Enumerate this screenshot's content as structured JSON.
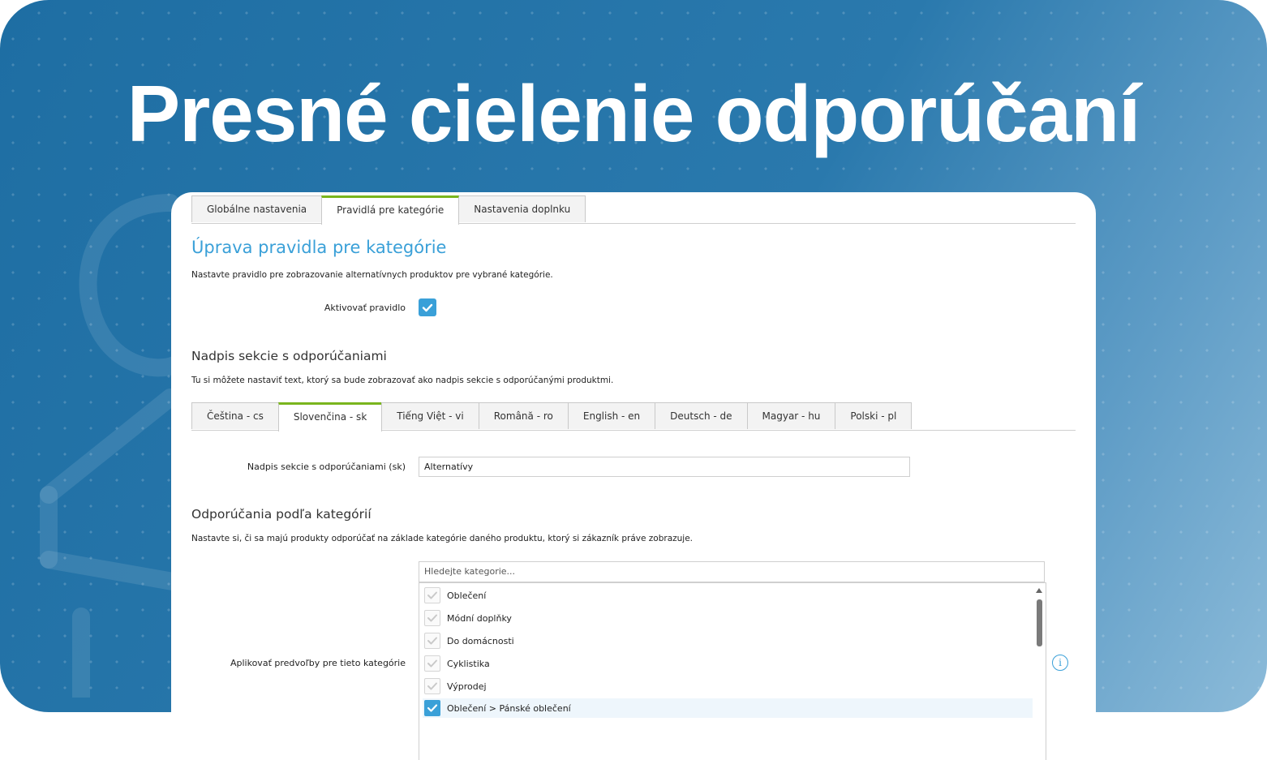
{
  "headline": "Presné cielenie odporúčaní",
  "colors": {
    "accent": "#3aa0d8",
    "tab_active": "#7ab51d",
    "background": "#2a79ad"
  },
  "main_tabs": [
    {
      "label": "Globálne nastavenia",
      "active": false
    },
    {
      "label": "Pravidlá pre kategórie",
      "active": true
    },
    {
      "label": "Nastavenia doplnku",
      "active": false
    }
  ],
  "rule": {
    "title": "Úprava pravidla pre kategórie",
    "description": "Nastavte pravidlo pre zobrazovanie alternatívnych produktov pre vybrané kategórie.",
    "activate_label": "Aktivovať pravidlo",
    "activate_checked": true
  },
  "heading_section": {
    "title": "Nadpis sekcie s odporúčaniami",
    "description": "Tu si môžete nastaviť text, ktorý sa bude zobrazovať ako nadpis sekcie s odporúčanými produktmi.",
    "languages": [
      {
        "label": "Čeština - cs",
        "active": false
      },
      {
        "label": "Slovenčina - sk",
        "active": true
      },
      {
        "label": "Tiếng Việt - vi",
        "active": false
      },
      {
        "label": "Română - ro",
        "active": false
      },
      {
        "label": "English - en",
        "active": false
      },
      {
        "label": "Deutsch - de",
        "active": false
      },
      {
        "label": "Magyar - hu",
        "active": false
      },
      {
        "label": "Polski - pl",
        "active": false
      }
    ],
    "field_label": "Nadpis sekcie s odporúčaniami (sk)",
    "field_value": "Alternatívy"
  },
  "category_section": {
    "title": "Odporúčania podľa kategórií",
    "description": "Nastavte si, či sa majú produkty odporúčať na základe kategórie daného produktu, ktorý si zákazník práve zobrazuje.",
    "apply_label": "Aplikovať predvoľby pre tieto kategórie",
    "search_placeholder": "Hledejte kategorie...",
    "categories": [
      {
        "label": "Oblečení",
        "checked": false
      },
      {
        "label": "Módní doplňky",
        "checked": false
      },
      {
        "label": "Do domácnosti",
        "checked": false
      },
      {
        "label": "Cyklistika",
        "checked": false
      },
      {
        "label": "Výprodej",
        "checked": false
      },
      {
        "label": "Oblečení > Pánské oblečení",
        "checked": true
      }
    ]
  }
}
